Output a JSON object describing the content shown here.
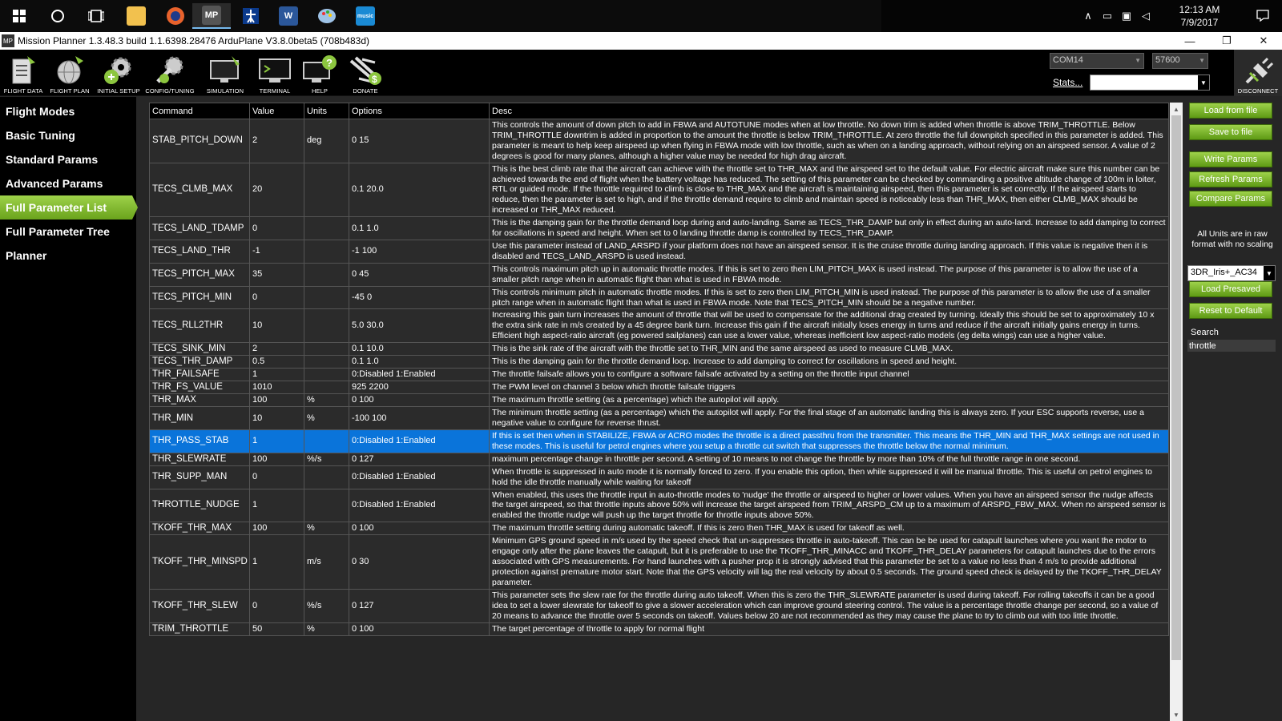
{
  "taskbar": {
    "apps": [
      {
        "icon": "windows-start-icon"
      },
      {
        "icon": "cortana-search-icon"
      },
      {
        "icon": "task-view-icon"
      },
      {
        "icon": "file-explorer-icon"
      },
      {
        "icon": "firefox-icon"
      },
      {
        "icon": "mission-planner-icon",
        "glyph": "MP"
      },
      {
        "icon": "app-figure-icon"
      },
      {
        "icon": "word-icon",
        "glyph": "W"
      },
      {
        "icon": "paint-icon"
      },
      {
        "icon": "music-icon",
        "glyph": "music"
      }
    ],
    "clock_time": "12:13 AM",
    "clock_date": "7/9/2017"
  },
  "window": {
    "title": "Mission Planner 1.3.48.3 build 1.1.6398.28476 ArduPlane V3.8.0beta5 (708b483d)",
    "logo": "MP"
  },
  "toolbar": {
    "items": [
      {
        "label": "FLIGHT DATA",
        "icon": "flight-data-icon"
      },
      {
        "label": "FLIGHT PLAN",
        "icon": "flight-plan-icon"
      },
      {
        "label": "INITIAL SETUP",
        "icon": "initial-setup-icon"
      },
      {
        "label": "CONFIG/TUNING",
        "icon": "config-tuning-icon"
      },
      {
        "label": "SIMULATION",
        "icon": "simulation-icon"
      },
      {
        "label": "TERMINAL",
        "icon": "terminal-icon"
      },
      {
        "label": "HELP",
        "icon": "help-icon"
      },
      {
        "label": "DONATE",
        "icon": "donate-icon"
      }
    ],
    "port": "COM14",
    "baud": "57600",
    "stats_label": "Stats...",
    "disconnect_label": "DISCONNECT"
  },
  "sidebar": {
    "items": [
      {
        "label": "Flight Modes",
        "active": false
      },
      {
        "label": "Basic Tuning",
        "active": false
      },
      {
        "label": "Standard Params",
        "active": false
      },
      {
        "label": "Advanced Params",
        "active": false
      },
      {
        "label": "Full Parameter List",
        "active": true
      },
      {
        "label": "Full Parameter Tree",
        "active": false
      },
      {
        "label": "Planner",
        "active": false
      }
    ]
  },
  "grid": {
    "columns": [
      "Command",
      "Value",
      "Units",
      "Options",
      "Desc"
    ],
    "rows": [
      {
        "command": "STAB_PITCH_DOWN",
        "value": "2",
        "units": "deg",
        "options": "0 15",
        "desc": "This controls the amount of down pitch to add in FBWA and AUTOTUNE modes when at low throttle. No down trim is added when throttle is above TRIM_THROTTLE. Below TRIM_THROTTLE downtrim is added in proportion to the amount the throttle is below TRIM_THROTTLE. At zero throttle the full downpitch specified in this parameter is added. This parameter is meant to help keep airspeed up when flying in FBWA mode with low throttle, such as when on a landing approach, without relying on an airspeed sensor. A value of 2 degrees is good for many planes, although a higher value may be needed for high drag aircraft.",
        "selected": false
      },
      {
        "command": "TECS_CLMB_MAX",
        "value": "20",
        "units": "",
        "options": "0.1 20.0",
        "desc": "This is the best climb rate that the aircraft can achieve with the throttle set to THR_MAX and the airspeed set to the default value. For electric aircraft make sure this number can be achieved towards the end of flight when the battery voltage has reduced. The setting of this parameter can be checked by commanding a positive altitude change of 100m in loiter, RTL or guided mode. If the throttle required to climb is close to THR_MAX and the aircraft is maintaining airspeed, then this parameter is set correctly. If the airspeed starts to reduce, then the parameter is set to high, and if the throttle demand require to climb and maintain speed is noticeably less than THR_MAX, then either CLMB_MAX should be increased or THR_MAX reduced.",
        "selected": false
      },
      {
        "command": "TECS_LAND_TDAMP",
        "value": "0",
        "units": "",
        "options": "0.1 1.0",
        "desc": "This is the damping gain for the throttle demand loop during and auto-landing. Same as TECS_THR_DAMP but only in effect during an auto-land. Increase to add damping to correct for oscillations in speed and height. When set to 0 landing throttle damp is controlled by TECS_THR_DAMP.",
        "selected": false
      },
      {
        "command": "TECS_LAND_THR",
        "value": "-1",
        "units": "",
        "options": "-1 100",
        "desc": "Use this parameter instead of LAND_ARSPD if your platform does not have an airspeed sensor.  It is the cruise throttle during landing approach.  If this value is negative then it is disabled and TECS_LAND_ARSPD is used instead.",
        "selected": false
      },
      {
        "command": "TECS_PITCH_MAX",
        "value": "35",
        "units": "",
        "options": "0 45",
        "desc": "This controls maximum pitch up in automatic throttle modes. If this is set to zero then LIM_PITCH_MAX is used instead. The purpose of this parameter is to allow the use of a smaller pitch range when in automatic flight than what is used in FBWA mode.",
        "selected": false
      },
      {
        "command": "TECS_PITCH_MIN",
        "value": "0",
        "units": "",
        "options": "-45 0",
        "desc": "This controls minimum pitch in automatic throttle modes. If this is set to zero then LIM_PITCH_MIN is used instead. The purpose of this parameter is to allow the use of a smaller pitch range when in automatic flight than what is used in FBWA mode. Note that TECS_PITCH_MIN should be a negative number.",
        "selected": false
      },
      {
        "command": "TECS_RLL2THR",
        "value": "10",
        "units": "",
        "options": "5.0 30.0",
        "desc": "Increasing this gain turn increases the amount of throttle that will be used to compensate for the additional drag created by turning. Ideally this should be set to approximately 10 x the extra sink rate in m/s created by a 45 degree bank turn. Increase this gain if the aircraft initially loses energy in turns and reduce if the aircraft initially gains energy in turns. Efficient high aspect-ratio aircraft (eg powered sailplanes) can use a lower value, whereas inefficient low aspect-ratio models (eg delta wings) can use a higher value.",
        "selected": false
      },
      {
        "command": "TECS_SINK_MIN",
        "value": "2",
        "units": "",
        "options": "0.1 10.0",
        "desc": "This is the sink rate of the aircraft with the throttle set to THR_MIN and the same airspeed as used to measure CLMB_MAX.",
        "selected": false
      },
      {
        "command": "TECS_THR_DAMP",
        "value": "0.5",
        "units": "",
        "options": "0.1 1.0",
        "desc": "This is the damping gain for the throttle demand loop. Increase to add damping  to correct for oscillations in speed and height.",
        "selected": false
      },
      {
        "command": "THR_FAILSAFE",
        "value": "1",
        "units": "",
        "options": "0:Disabled 1:Enabled",
        "desc": "The throttle failsafe allows you to configure a software failsafe activated by a setting on the throttle input channel",
        "selected": false
      },
      {
        "command": "THR_FS_VALUE",
        "value": "1010",
        "units": "",
        "options": "925 2200",
        "desc": "The PWM level on channel 3 below which throttle failsafe triggers",
        "selected": false
      },
      {
        "command": "THR_MAX",
        "value": "100",
        "units": "%",
        "options": "0 100",
        "desc": "The maximum throttle setting (as a percentage) which the autopilot will apply.",
        "selected": false
      },
      {
        "command": "THR_MIN",
        "value": "10",
        "units": "%",
        "options": "-100 100",
        "desc": "The minimum throttle setting (as a percentage) which the autopilot will apply. For the final stage of an automatic landing this is always zero. If your ESC supports reverse, use a negative value to configure for reverse thrust.",
        "selected": false
      },
      {
        "command": "THR_PASS_STAB",
        "value": "1",
        "units": "",
        "options": "0:Disabled 1:Enabled",
        "desc": "If this is set then when in STABILIZE, FBWA or ACRO modes the throttle is a direct passthru from the transmitter. This means the THR_MIN and THR_MAX settings are not used in these modes. This is useful for petrol engines where you setup a throttle cut switch that suppresses the throttle below the normal minimum.",
        "selected": true
      },
      {
        "command": "THR_SLEWRATE",
        "value": "100",
        "units": "%/s",
        "options": "0 127",
        "desc": "maximum percentage change in throttle per second. A setting of 10 means to not change the throttle by more than 10% of the full throttle range in one second.",
        "selected": false
      },
      {
        "command": "THR_SUPP_MAN",
        "value": "0",
        "units": "",
        "options": "0:Disabled 1:Enabled",
        "desc": "When throttle is suppressed in auto mode it is normally forced to zero. If you enable this option, then while suppressed it will be manual throttle. This is useful on petrol engines to hold the idle throttle manually while waiting for takeoff",
        "selected": false
      },
      {
        "command": "THROTTLE_NUDGE",
        "value": "1",
        "units": "",
        "options": "0:Disabled 1:Enabled",
        "desc": "When enabled, this uses the throttle input in auto-throttle modes to 'nudge' the throttle or airspeed to higher or lower values. When you have an airspeed sensor the nudge affects the target airspeed, so that throttle inputs above 50% will increase the target airspeed from TRIM_ARSPD_CM up to a maximum of ARSPD_FBW_MAX. When no airspeed sensor is enabled the throttle nudge will push up the target throttle for throttle inputs above 50%.",
        "selected": false
      },
      {
        "command": "TKOFF_THR_MAX",
        "value": "100",
        "units": "%",
        "options": "0 100",
        "desc": "The maximum throttle setting during automatic takeoff. If this is zero then THR_MAX is used for takeoff as well.",
        "selected": false
      },
      {
        "command": "TKOFF_THR_MINSPD",
        "value": "1",
        "units": "m/s",
        "options": "0 30",
        "desc": "Minimum GPS ground speed in m/s used by the speed check that un-suppresses throttle in auto-takeoff. This can be be used for catapult launches where you want the motor to engage only after the plane leaves the catapult, but it is preferable to use the TKOFF_THR_MINACC and TKOFF_THR_DELAY parameters for catapult launches due to the errors associated with GPS measurements. For hand launches with a pusher prop it is strongly advised that this parameter be set to a value no less than 4 m/s to provide additional protection against premature motor start. Note that the GPS velocity will lag the real velocity by about 0.5 seconds. The ground speed check is delayed by the TKOFF_THR_DELAY parameter.",
        "selected": false
      },
      {
        "command": "TKOFF_THR_SLEW",
        "value": "0",
        "units": "%/s",
        "options": "0 127",
        "desc": "This parameter sets the slew rate for the throttle during auto takeoff. When this is zero the THR_SLEWRATE parameter is used during takeoff. For rolling takeoffs it can be a good idea to set a lower slewrate for takeoff to give a slower acceleration which can improve ground steering control. The value is a percentage throttle change per second, so a value of 20 means to advance the throttle over 5 seconds on takeoff. Values below 20 are not recommended as they may cause the plane to try to climb out with too little throttle.",
        "selected": false
      },
      {
        "command": "TRIM_THROTTLE",
        "value": "50",
        "units": "%",
        "options": "0 100",
        "desc": "The target percentage of throttle to apply for normal flight",
        "selected": false
      }
    ]
  },
  "rightpanel": {
    "load_from_file": "Load from file",
    "save_to_file": "Save to file",
    "write_params": "Write Params",
    "refresh_params": "Refresh Params",
    "compare_params": "Compare Params",
    "units_note": "All Units are in raw format with no scaling",
    "profile": "3DR_Iris+_AC34",
    "load_presaved": "Load Presaved",
    "reset_default": "Reset to Default",
    "search_label": "Search",
    "search_value": "throttle"
  },
  "colors": {
    "accent_green": "#7cb82f",
    "selection_blue": "#0a74da"
  }
}
